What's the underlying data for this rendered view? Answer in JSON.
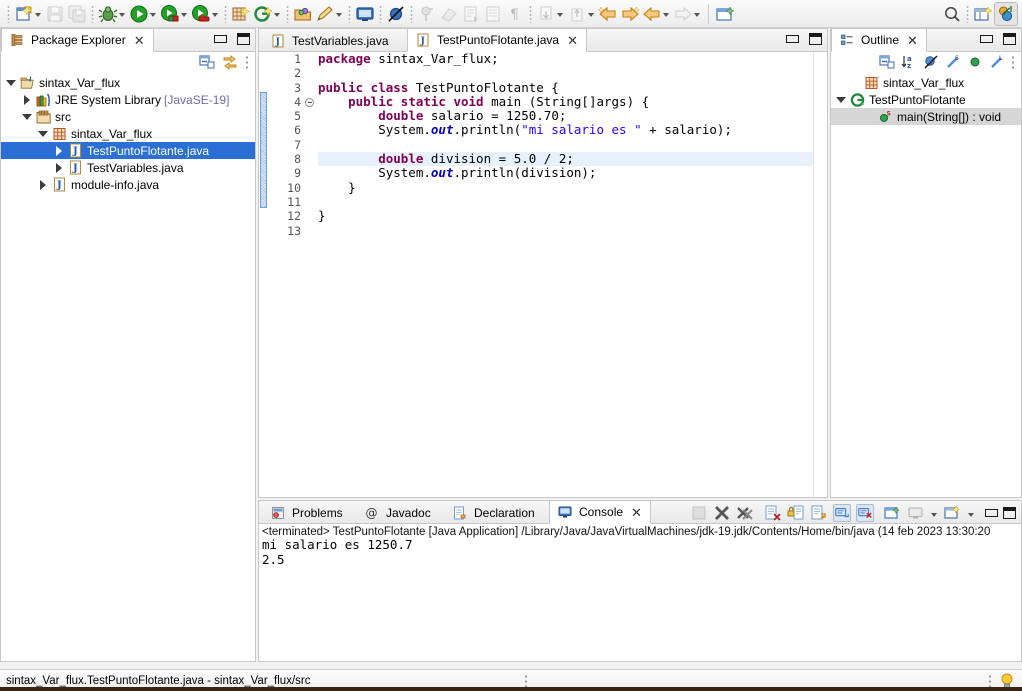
{
  "toolbar": {
    "items": [
      {
        "name": "new-wizard",
        "icon": "new-file-icon",
        "dropdown": true
      },
      {
        "name": "save",
        "icon": "save-icon",
        "dropdown": false,
        "disabled": true
      },
      {
        "name": "save-all",
        "icon": "save-all-icon",
        "dropdown": false,
        "disabled": true
      },
      {
        "name": "debug",
        "icon": "debug-bug-icon",
        "dropdown": true
      },
      {
        "name": "run",
        "icon": "run-play-icon",
        "dropdown": true
      },
      {
        "name": "run-external-tools",
        "icon": "external-tools-icon",
        "dropdown": true
      },
      {
        "name": "coverage",
        "icon": "coverage-icon",
        "dropdown": true
      },
      {
        "name": "new-java-package",
        "icon": "new-package-icon",
        "dropdown": false
      },
      {
        "name": "new-java-project",
        "icon": "new-java-project-icon",
        "dropdown": true
      },
      {
        "name": "open-type",
        "icon": "open-type-icon",
        "dropdown": false
      },
      {
        "name": "new-java-class",
        "icon": "new-class-icon",
        "dropdown": true
      },
      {
        "name": "open-console",
        "icon": "console-icon",
        "dropdown": false
      },
      {
        "name": "skip-breakpoints",
        "icon": "skip-breakpoints-icon",
        "dropdown": false
      },
      {
        "name": "pin-editor",
        "icon": "pin-icon",
        "dropdown": false,
        "disabled": true
      },
      {
        "name": "eraser",
        "icon": "eraser-icon",
        "dropdown": false,
        "disabled": true
      },
      {
        "name": "next-annotation",
        "icon": "next-annotation-icon",
        "dropdown": false,
        "disabled": true
      },
      {
        "name": "toggle-block-selection",
        "icon": "block-selection-icon",
        "dropdown": false,
        "disabled": true
      },
      {
        "name": "show-whitespace",
        "icon": "pilcrow-icon",
        "dropdown": false,
        "disabled": true
      },
      {
        "name": "next-edit",
        "icon": "next-edit-icon",
        "dropdown": true,
        "disabled": true
      },
      {
        "name": "previous-edit",
        "icon": "previous-edit-icon",
        "dropdown": true,
        "disabled": true
      },
      {
        "name": "back",
        "icon": "back-arrow-icon",
        "dropdown": false
      },
      {
        "name": "forward",
        "icon": "forward-arrow-icon",
        "dropdown": false
      },
      {
        "name": "back-history",
        "icon": "back-history-icon",
        "dropdown": true
      },
      {
        "name": "forward-history",
        "icon": "forward-history-icon",
        "dropdown": true,
        "disabled": true
      },
      {
        "name": "new-window",
        "icon": "new-window-icon",
        "dropdown": false
      }
    ],
    "right_items": [
      {
        "name": "quick-access-search",
        "icon": "search-icon"
      },
      {
        "name": "open-perspective",
        "icon": "open-perspective-icon"
      },
      {
        "name": "java-perspective",
        "icon": "java-perspective-icon",
        "active": true
      }
    ]
  },
  "package_explorer": {
    "tab_label": "Package Explorer",
    "tab_icon": "package-explorer-icon",
    "close_label": "✕",
    "toolbar_icons": [
      "collapse-all-icon",
      "link-with-editor-icon",
      "view-menu-icon"
    ],
    "tree": [
      {
        "label": "sintax_Var_flux",
        "icon": "java-project-icon",
        "twisty": "down",
        "indent": 0,
        "selected": false,
        "suffix": ""
      },
      {
        "label": "JRE System Library",
        "icon": "jre-library-icon",
        "twisty": "right",
        "indent": 1,
        "selected": false,
        "suffix": "[JavaSE-19]"
      },
      {
        "label": "src",
        "icon": "source-folder-icon",
        "twisty": "down",
        "indent": 1,
        "selected": false,
        "suffix": ""
      },
      {
        "label": "sintax_Var_flux",
        "icon": "package-icon",
        "twisty": "down",
        "indent": 2,
        "selected": false,
        "suffix": ""
      },
      {
        "label": "TestPuntoFlotante.java",
        "icon": "java-file-icon",
        "twisty": "right",
        "indent": 3,
        "selected": true,
        "suffix": ""
      },
      {
        "label": "TestVariables.java",
        "icon": "java-file-icon",
        "twisty": "right",
        "indent": 3,
        "selected": false,
        "suffix": ""
      },
      {
        "label": "module-info.java",
        "icon": "java-file-icon",
        "twisty": "right",
        "indent": 2,
        "selected": false,
        "suffix": ""
      }
    ]
  },
  "editor": {
    "tabs": [
      {
        "label": "TestVariables.java",
        "icon": "java-file-icon",
        "active": false,
        "closable": false
      },
      {
        "label": "TestPuntoFlotante.java",
        "icon": "java-file-icon",
        "active": true,
        "closable": true
      }
    ],
    "close_label": "✕",
    "line_numbers": [
      "1",
      "2",
      "3",
      "4",
      "5",
      "6",
      "7",
      "8",
      "9",
      "10",
      "11",
      "12",
      "13"
    ],
    "highlighted_line": 8,
    "fold_marker_line": 4,
    "lines": [
      {
        "n": 1,
        "tokens": [
          {
            "t": "package ",
            "c": "kw"
          },
          {
            "t": "sintax_Var_flux;",
            "c": "pln"
          }
        ]
      },
      {
        "n": 2,
        "tokens": []
      },
      {
        "n": 3,
        "tokens": [
          {
            "t": "public class ",
            "c": "kw"
          },
          {
            "t": "TestPuntoFlotante {",
            "c": "pln"
          }
        ]
      },
      {
        "n": 4,
        "tokens": [
          {
            "t": "    ",
            "c": "pln"
          },
          {
            "t": "public static void ",
            "c": "kw"
          },
          {
            "t": "main (String[]args) {",
            "c": "pln"
          }
        ]
      },
      {
        "n": 5,
        "tokens": [
          {
            "t": "        ",
            "c": "pln"
          },
          {
            "t": "double ",
            "c": "kw"
          },
          {
            "t": "salario = 1250.70;",
            "c": "pln"
          }
        ]
      },
      {
        "n": 6,
        "tokens": [
          {
            "t": "        System.",
            "c": "pln"
          },
          {
            "t": "out",
            "c": "fld"
          },
          {
            "t": ".println(",
            "c": "pln"
          },
          {
            "t": "\"mi salario es \"",
            "c": "str"
          },
          {
            "t": " + salario);",
            "c": "pln"
          }
        ]
      },
      {
        "n": 7,
        "tokens": []
      },
      {
        "n": 8,
        "tokens": [
          {
            "t": "        ",
            "c": "pln"
          },
          {
            "t": "double ",
            "c": "kw"
          },
          {
            "t": "division = 5.0 / 2;",
            "c": "pln"
          }
        ]
      },
      {
        "n": 9,
        "tokens": [
          {
            "t": "        System.",
            "c": "pln"
          },
          {
            "t": "out",
            "c": "fld"
          },
          {
            "t": ".println(division);",
            "c": "pln"
          }
        ]
      },
      {
        "n": 10,
        "tokens": [
          {
            "t": "    }",
            "c": "pln"
          }
        ]
      },
      {
        "n": 11,
        "tokens": []
      },
      {
        "n": 12,
        "tokens": [
          {
            "t": "}",
            "c": "pln"
          }
        ]
      },
      {
        "n": 13,
        "tokens": []
      }
    ]
  },
  "outline": {
    "tab_label": "Outline",
    "tab_icon": "outline-icon",
    "close_label": "✕",
    "toolbar_icons": [
      "collapse-all-icon",
      "sort-alpha-icon",
      "hide-fields-icon",
      "hide-static-icon",
      "hide-nonpublic-icon",
      "hide-local-types-icon",
      "view-menu-icon"
    ],
    "tree": [
      {
        "label": "sintax_Var_flux",
        "icon": "package-icon",
        "twisty": "none",
        "indent": 1,
        "selected": false
      },
      {
        "label": "TestPuntoFlotante",
        "icon": "java-class-icon",
        "twisty": "down",
        "indent": 0,
        "selected": false
      },
      {
        "label": "main(String[]) : void",
        "icon": "public-method-icon",
        "twisty": "none",
        "indent": 2,
        "selected": true
      }
    ]
  },
  "bottom": {
    "tabs": [
      {
        "label": "Problems",
        "icon": "problems-icon",
        "active": false,
        "closable": false
      },
      {
        "label": "Javadoc",
        "icon": "javadoc-icon",
        "active": false,
        "closable": false
      },
      {
        "label": "Declaration",
        "icon": "declaration-icon",
        "active": false,
        "closable": false
      },
      {
        "label": "Console",
        "icon": "console-icon",
        "active": true,
        "closable": true
      }
    ],
    "close_label": "✕",
    "toolbar_icons": [
      {
        "name": "terminate-button",
        "icon": "terminate-icon",
        "disabled": true
      },
      {
        "name": "remove-launch-button",
        "icon": "remove-launch-icon",
        "disabled": false
      },
      {
        "name": "remove-all-terminated-button",
        "icon": "remove-all-icon",
        "disabled": false
      },
      {
        "name": "clear-console-button",
        "icon": "clear-console-icon",
        "disabled": false
      },
      {
        "name": "scroll-lock-button",
        "icon": "scroll-lock-icon",
        "disabled": false
      },
      {
        "name": "word-wrap-button",
        "icon": "word-wrap-icon",
        "disabled": false
      },
      {
        "name": "show-console-on-output-button",
        "icon": "show-console-output-icon",
        "pressed": true
      },
      {
        "name": "show-console-on-error-button",
        "icon": "show-console-error-icon",
        "pressed": true
      },
      {
        "name": "pin-console-button",
        "icon": "pin-console-icon",
        "disabled": false
      },
      {
        "name": "display-selected-console-button",
        "icon": "display-console-icon",
        "dropdown": true
      },
      {
        "name": "open-console-button",
        "icon": "open-console-icon",
        "dropdown": true
      }
    ],
    "console": {
      "header": "<terminated> TestPuntoFlotante [Java Application] /Library/Java/JavaVirtualMachines/jdk-19.jdk/Contents/Home/bin/java  (14 feb 2023 13:30:20",
      "output": [
        "mi salario es 1250.7",
        "2.5"
      ]
    }
  },
  "statusbar": {
    "text": "sintax_Var_flux.TestPuntoFlotante.java - sintax_Var_flux/src",
    "right_icon": "smart-insert-lamp-icon"
  },
  "colors": {
    "selection_blue": "#2b6fd4",
    "keyword": "#7f0055",
    "string": "#2a00ff",
    "field": "#0000c0",
    "line_highlight": "#e8f0fb",
    "panel_border": "#c8c8c8",
    "toolbar_bg": "#ececec"
  }
}
